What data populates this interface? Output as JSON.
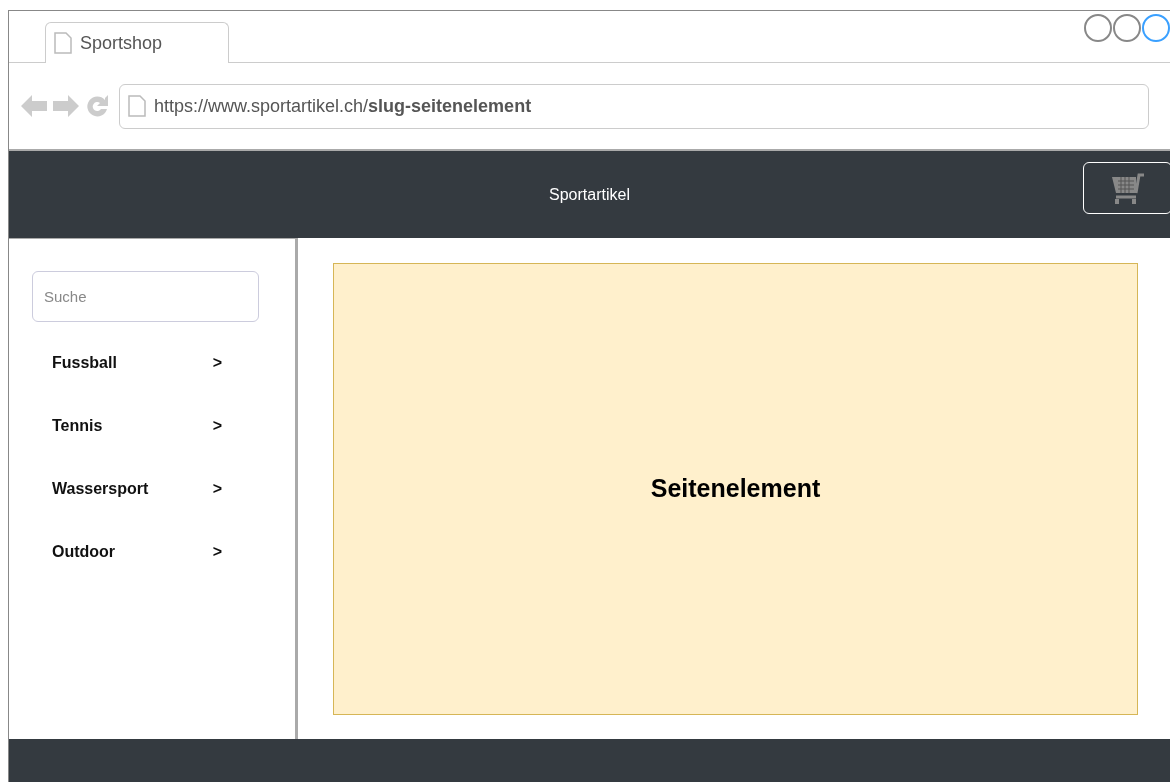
{
  "browser": {
    "tab_title": "Sportshop",
    "url": "https://www.sportartikel.ch/**slug-seitenelement**"
  },
  "header": {
    "title": "Sportartikel"
  },
  "sidebar": {
    "search": {
      "placeholder": "Suche"
    },
    "items": [
      {
        "label": "Fussball",
        "arrow": ">"
      },
      {
        "label": "Tennis",
        "arrow": ">"
      },
      {
        "label": "Wassersport",
        "arrow": ">"
      },
      {
        "label": "Outdoor",
        "arrow": ">"
      }
    ]
  },
  "content": {
    "title": "Seitenelement"
  }
}
